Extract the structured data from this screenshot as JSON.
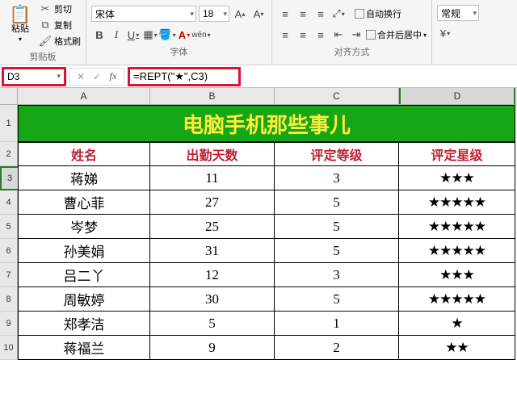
{
  "ribbon": {
    "paste_label": "粘贴",
    "cut_label": "剪切",
    "copy_label": "复制",
    "format_painter_label": "格式刷",
    "clipboard_title": "剪贴板",
    "font_name": "宋体",
    "font_size": "18",
    "font_title": "字体",
    "wrap_label": "自动换行",
    "merge_label": "合并后居中",
    "align_title": "对齐方式",
    "number_format": "常规"
  },
  "formula": {
    "cell_ref": "D3",
    "formula_text": "=REPT(\"★\",C3)"
  },
  "columns": [
    "A",
    "B",
    "C",
    "D"
  ],
  "title": "电脑手机那些事儿",
  "headers": {
    "name": "姓名",
    "days": "出勤天数",
    "level": "评定等级",
    "stars": "评定星级"
  },
  "data": [
    {
      "name": "蒋娣",
      "days": "11",
      "level": "3",
      "stars": "★★★"
    },
    {
      "name": "曹心菲",
      "days": "27",
      "level": "5",
      "stars": "★★★★★"
    },
    {
      "name": "岑梦",
      "days": "25",
      "level": "5",
      "stars": "★★★★★"
    },
    {
      "name": "孙美娟",
      "days": "31",
      "level": "5",
      "stars": "★★★★★"
    },
    {
      "name": "吕二丫",
      "days": "12",
      "level": "3",
      "stars": "★★★"
    },
    {
      "name": "周敏婷",
      "days": "30",
      "level": "5",
      "stars": "★★★★★"
    },
    {
      "name": "郑孝洁",
      "days": "5",
      "level": "1",
      "stars": "★"
    },
    {
      "name": "蒋福兰",
      "days": "9",
      "level": "2",
      "stars": "★★"
    }
  ],
  "chart_data": {
    "type": "table",
    "title": "电脑手机那些事儿",
    "columns": [
      "姓名",
      "出勤天数",
      "评定等级",
      "评定星级"
    ],
    "rows": [
      [
        "蒋娣",
        11,
        3,
        "★★★"
      ],
      [
        "曹心菲",
        27,
        5,
        "★★★★★"
      ],
      [
        "岑梦",
        25,
        5,
        "★★★★★"
      ],
      [
        "孙美娟",
        31,
        5,
        "★★★★★"
      ],
      [
        "吕二丫",
        12,
        3,
        "★★★"
      ],
      [
        "周敏婷",
        30,
        5,
        "★★★★★"
      ],
      [
        "郑孝洁",
        5,
        1,
        "★"
      ],
      [
        "蒋福兰",
        9,
        2,
        "★★"
      ]
    ]
  }
}
